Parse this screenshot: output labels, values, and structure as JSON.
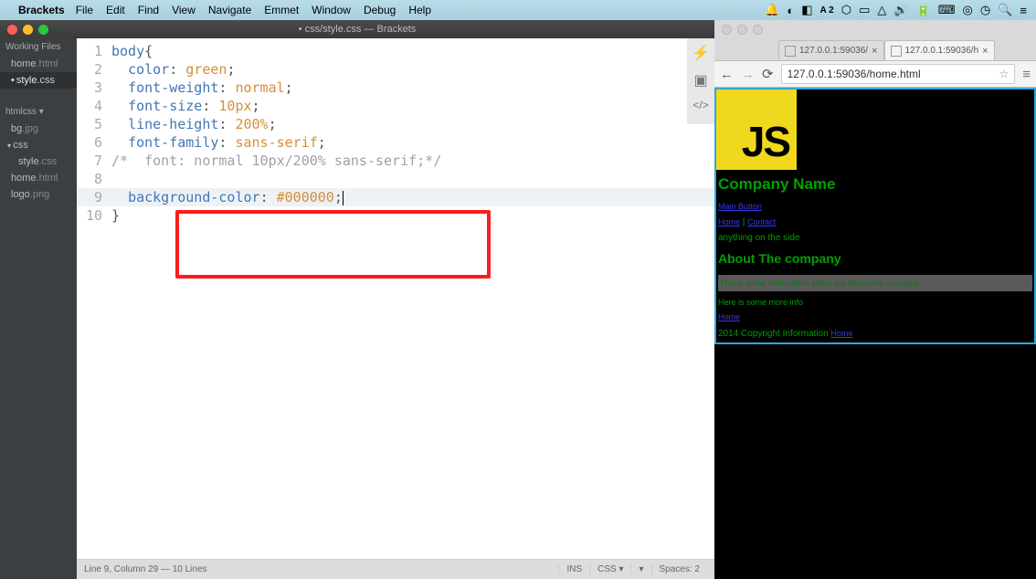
{
  "mac_menu": {
    "app_name": "Brackets",
    "items": [
      "File",
      "Edit",
      "Find",
      "View",
      "Navigate",
      "Emmet",
      "Window",
      "Debug",
      "Help"
    ]
  },
  "brackets": {
    "title": "• css/style.css — Brackets",
    "sidebar": {
      "working_files_title": "Working Files",
      "working_files": [
        {
          "name": "home",
          "ext": ".html",
          "active": false
        },
        {
          "name": "style",
          "ext": ".css",
          "active": true
        }
      ],
      "project_title": "htmlcss",
      "project_tree": [
        {
          "name": "bg",
          "ext": ".jpg",
          "depth": 1
        },
        {
          "name": "css",
          "ext": "",
          "depth": 1,
          "folder": true
        },
        {
          "name": "style",
          "ext": ".css",
          "depth": 2
        },
        {
          "name": "home",
          "ext": ".html",
          "depth": 1
        },
        {
          "name": "logo",
          "ext": ".png",
          "depth": 1
        }
      ]
    },
    "code": {
      "lines": [
        [
          {
            "t": "body",
            "c": "tok-selector"
          },
          {
            "t": "{",
            "c": "tok-plain"
          }
        ],
        [
          {
            "t": "  ",
            "c": "tok-plain"
          },
          {
            "t": "color",
            "c": "tok-prop"
          },
          {
            "t": ": ",
            "c": "tok-plain"
          },
          {
            "t": "green",
            "c": "tok-value-kw"
          },
          {
            "t": ";",
            "c": "tok-plain"
          }
        ],
        [
          {
            "t": "  ",
            "c": "tok-plain"
          },
          {
            "t": "font-weight",
            "c": "tok-prop"
          },
          {
            "t": ": ",
            "c": "tok-plain"
          },
          {
            "t": "normal",
            "c": "tok-value-kw"
          },
          {
            "t": ";",
            "c": "tok-plain"
          }
        ],
        [
          {
            "t": "  ",
            "c": "tok-plain"
          },
          {
            "t": "font-size",
            "c": "tok-prop"
          },
          {
            "t": ": ",
            "c": "tok-plain"
          },
          {
            "t": "10px",
            "c": "tok-value-kw"
          },
          {
            "t": ";",
            "c": "tok-plain"
          }
        ],
        [
          {
            "t": "  ",
            "c": "tok-plain"
          },
          {
            "t": "line-height",
            "c": "tok-prop"
          },
          {
            "t": ": ",
            "c": "tok-plain"
          },
          {
            "t": "200%",
            "c": "tok-value-kw"
          },
          {
            "t": ";",
            "c": "tok-plain"
          }
        ],
        [
          {
            "t": "  ",
            "c": "tok-plain"
          },
          {
            "t": "font-family",
            "c": "tok-prop"
          },
          {
            "t": ": ",
            "c": "tok-plain"
          },
          {
            "t": "sans-serif",
            "c": "tok-value-kw"
          },
          {
            "t": ";",
            "c": "tok-plain"
          }
        ],
        [
          {
            "t": "/*  font: normal 10px/200% sans-serif;*/",
            "c": "tok-comment"
          }
        ],
        [],
        [
          {
            "t": "  ",
            "c": "tok-plain"
          },
          {
            "t": "background-color",
            "c": "tok-prop"
          },
          {
            "t": ": ",
            "c": "tok-plain"
          },
          {
            "t": "#000000",
            "c": "tok-value-kw"
          },
          {
            "t": ";",
            "c": "tok-plain"
          }
        ],
        [
          {
            "t": "}",
            "c": "tok-plain"
          }
        ]
      ]
    },
    "statusbar": {
      "left": "Line 9, Column 29 — 10 Lines",
      "ins": "INS",
      "lang": "CSS",
      "enc": "▾",
      "spaces": "Spaces: 2"
    }
  },
  "chrome": {
    "tabs": [
      {
        "label": "127.0.0.1:59036/",
        "active": false
      },
      {
        "label": "127.0.0.1:59036/h",
        "active": true
      }
    ],
    "url": "127.0.0.1:59036/home.html"
  },
  "page": {
    "js_logo": "JS",
    "company_name": "Company Name",
    "main_button": "Main Button",
    "nav_home": "Home",
    "nav_sep": " | ",
    "nav_contact": "Contact",
    "side_text": "anything on the side",
    "about_heading": "About The company",
    "info_band": "This is some information about our Awesome company",
    "more_info": "Here is some more info",
    "footer_home": "Home",
    "copyright": "2014 Copyright Information ",
    "copyright_link": "Home"
  }
}
